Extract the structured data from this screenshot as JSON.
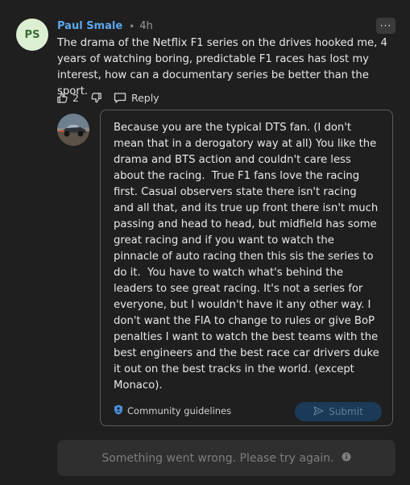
{
  "comment": {
    "avatar_initials": "PS",
    "author": "Paul Smale",
    "separator": "•",
    "time": "4h",
    "more_label": "···",
    "text": "The drama of the Netflix F1 series on the drives hooked me, 4 years of watching boring, predictable F1 races has lost my interest, how can a documentary series be better than the sport.",
    "actions": {
      "like_count": "2",
      "reply_label": "Reply"
    }
  },
  "reply_editor": {
    "avatar_icon": "race-car-avatar-icon",
    "text": "Because you are the typical DTS fan. (I don't mean that in a derogatory way at all) You like the drama and BTS action and couldn't care less about the racing.  True F1 fans love the racing first. Casual observers state there isn't racing and all that, and its true up front there isn't much passing and head to head, but midfield has some great racing and if you want to watch the pinnacle of auto racing then this sis the series to do it.  You have to watch what's behind the leaders to see great racing. It's not a series for everyone, but I wouldn't have it any other way. I don't want the FIA to change to rules or give BoP penalties I want to watch the best teams with the best engineers and the best race car drivers duke it out on the best tracks in the world. (except Monaco).",
    "guidelines_label": "Community guidelines",
    "submit_label": "Submit"
  },
  "error": {
    "message": "Something went wrong. Please try again."
  },
  "colors": {
    "background": "#1f1f1f",
    "author": "#5ba7f0",
    "avatar_bg": "#dcefd3",
    "submit_bg": "#1b3a57",
    "guidelines_icon": "#4a90d9"
  }
}
